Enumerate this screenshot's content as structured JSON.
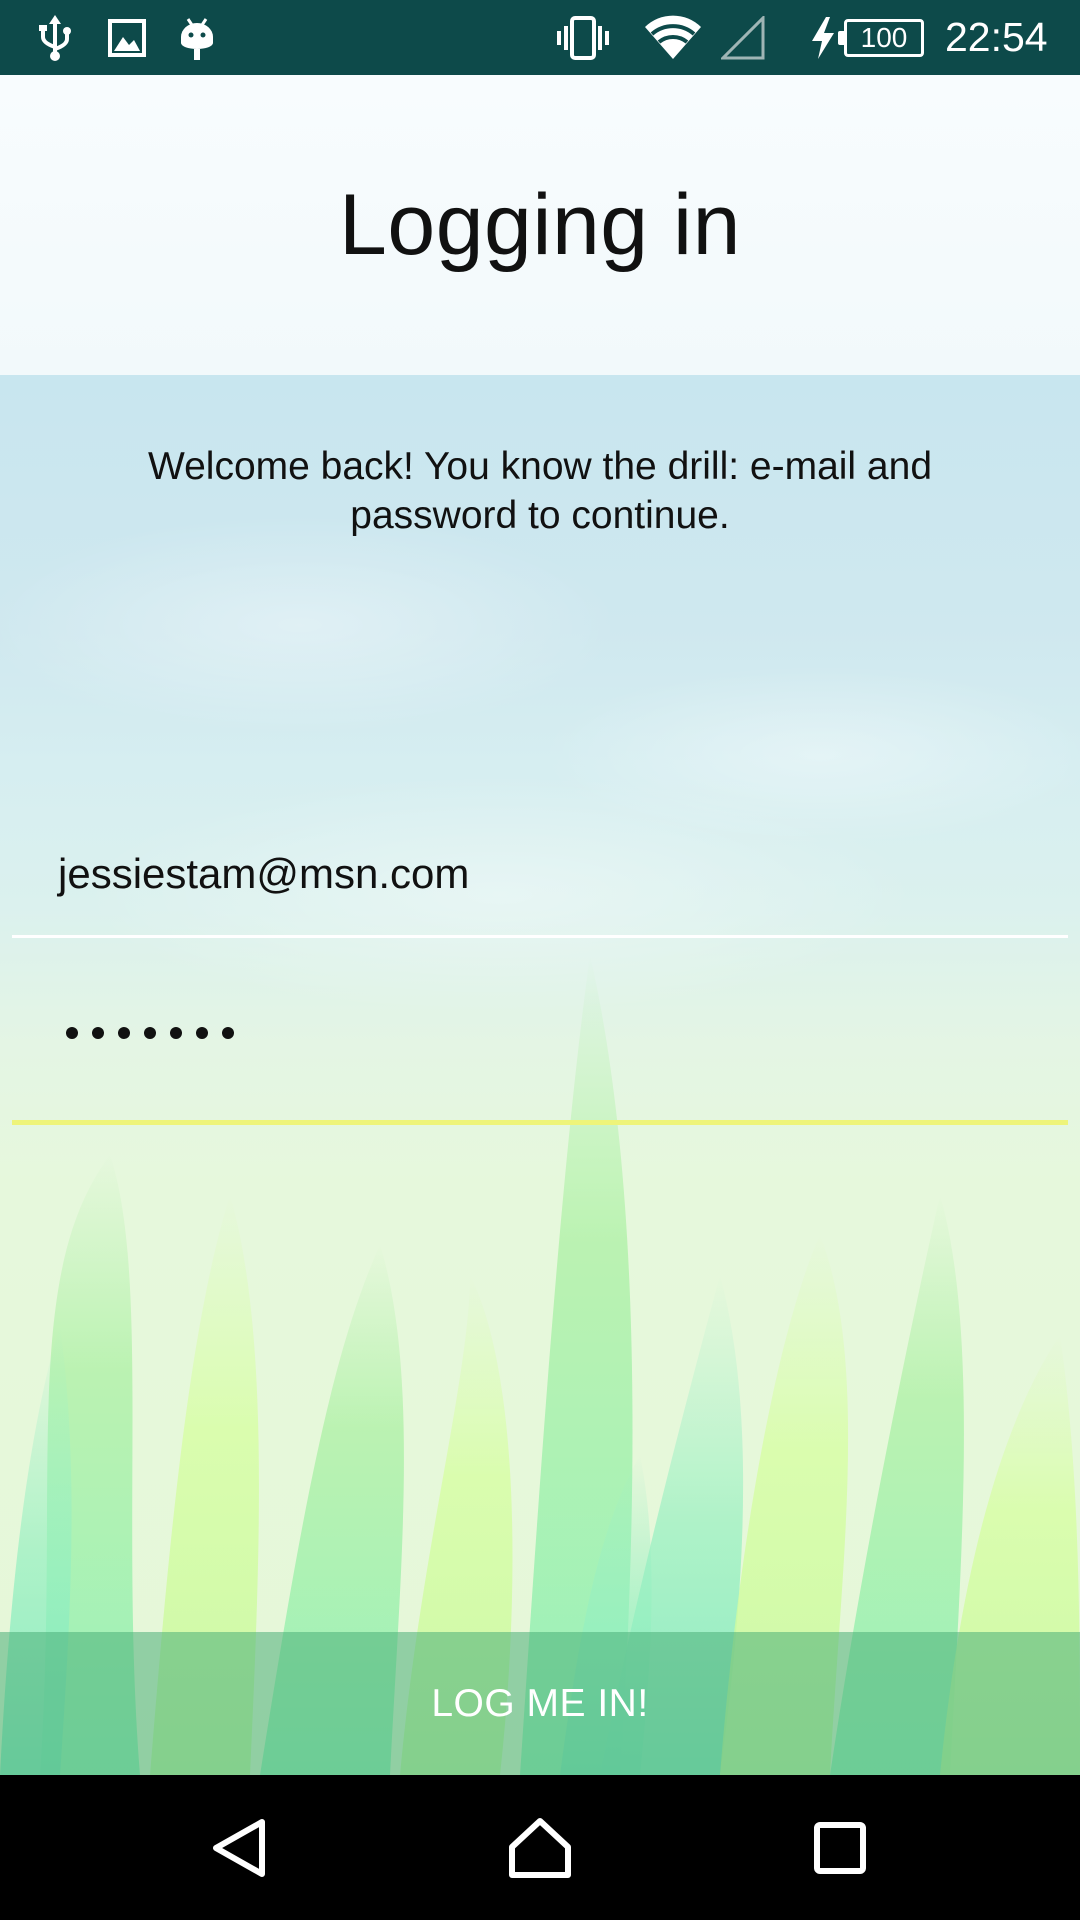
{
  "status_bar": {
    "battery_level": "100",
    "time": "22:54",
    "icons": [
      "usb-icon",
      "image-icon",
      "android-debug-icon",
      "vibrate-icon",
      "wifi-icon",
      "cellular-signal-icon",
      "charging-icon",
      "battery-icon"
    ],
    "background_color": "#0d4a4a"
  },
  "header": {
    "title": "Logging in"
  },
  "main": {
    "welcome_text": "Welcome back! You know the drill: e-mail and password to continue.",
    "email_value": "jessiestam@msn.com",
    "password_masked_length": 7,
    "login_button_label": "LOG ME IN!",
    "accent_underline_color": "#eef47a"
  },
  "nav_bar": {
    "buttons": [
      "back-icon",
      "home-icon",
      "recents-icon"
    ]
  }
}
